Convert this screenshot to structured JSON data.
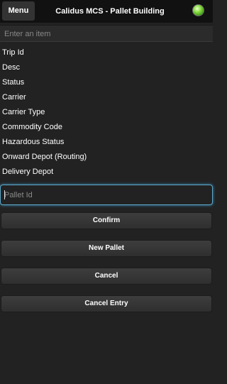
{
  "header": {
    "menu_label": "Menu",
    "title": "Calidus MCS - Pallet Building",
    "status_icon": "connection-status-green-icon",
    "status_color": "#5ac21e"
  },
  "search": {
    "placeholder": "Enter an item",
    "value": ""
  },
  "fields": [
    {
      "label": "Trip Id"
    },
    {
      "label": "Desc"
    },
    {
      "label": "Status"
    },
    {
      "label": "Carrier"
    },
    {
      "label": "Carrier Type"
    },
    {
      "label": "Commodity Code"
    },
    {
      "label": "Hazardous Status"
    },
    {
      "label": "Onward Depot (Routing)"
    },
    {
      "label": "Delivery Depot"
    }
  ],
  "pallet_input": {
    "placeholder": "Pallet Id",
    "value": ""
  },
  "buttons": {
    "confirm": "Confirm",
    "new_pallet": "New Pallet",
    "cancel": "Cancel",
    "cancel_entry": "Cancel Entry"
  },
  "colors": {
    "background": "#222222",
    "header": "#111111",
    "focus_glow": "#5ea8c9"
  }
}
